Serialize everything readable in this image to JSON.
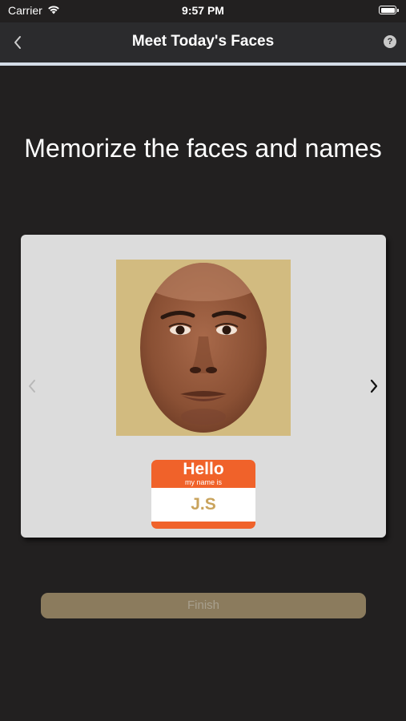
{
  "status_bar": {
    "carrier": "Carrier",
    "time": "9:57 PM",
    "battery_level": 1.0
  },
  "nav": {
    "title": "Meet Today's Faces",
    "back_icon": "chevron-left-icon",
    "help_icon": "question-circle-icon",
    "help_glyph": "?"
  },
  "main": {
    "instruction": "Memorize the faces and names"
  },
  "card": {
    "face_background_color": "#d2bb80",
    "prev_icon": "chevron-left-icon",
    "next_icon": "chevron-right-icon",
    "name_tag": {
      "hello": "Hello",
      "subtitle": "my name is",
      "name": "J.S",
      "tag_color": "#f0622a",
      "name_color": "#c9a35c"
    }
  },
  "finish_button": {
    "label": "Finish",
    "color": "#8b7b5d"
  }
}
